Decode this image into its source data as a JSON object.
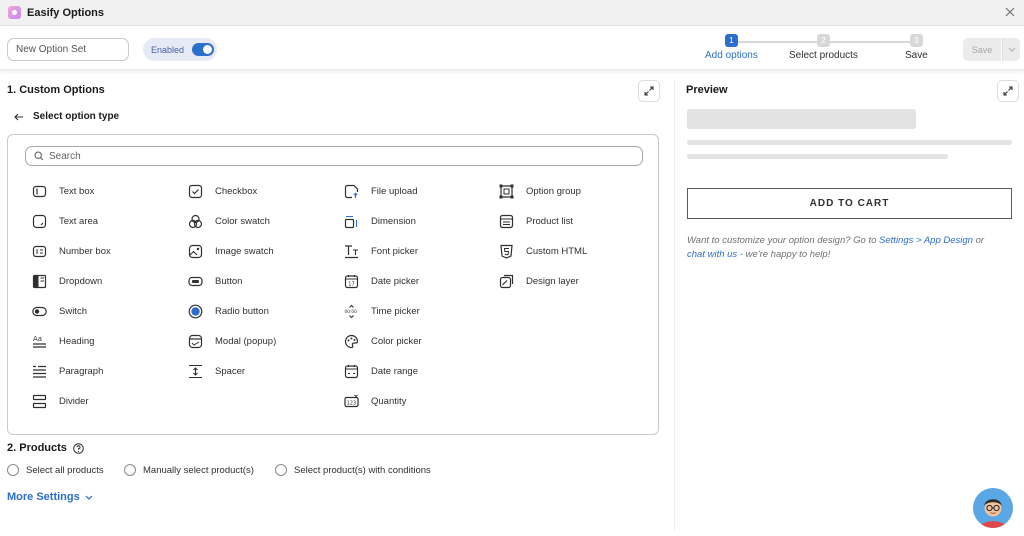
{
  "app": {
    "title": "Easify Options"
  },
  "toolbar": {
    "name_placeholder": "New Option Set",
    "enabled_label": "Enabled",
    "save_label": "Save",
    "steps": [
      {
        "num": "1",
        "label": "Add options",
        "active": true
      },
      {
        "num": "2",
        "label": "Select products",
        "active": false
      },
      {
        "num": "3",
        "label": "Save",
        "active": false
      }
    ]
  },
  "custom_options": {
    "title": "1. Custom Options",
    "back_label": "Select option type",
    "search_placeholder": "Search",
    "types": [
      {
        "label": "Text box",
        "icon": "text-box-icon"
      },
      {
        "label": "Text area",
        "icon": "text-area-icon"
      },
      {
        "label": "Number box",
        "icon": "number-box-icon"
      },
      {
        "label": "Dropdown",
        "icon": "dropdown-icon"
      },
      {
        "label": "Switch",
        "icon": "switch-icon"
      },
      {
        "label": "Heading",
        "icon": "heading-icon"
      },
      {
        "label": "Paragraph",
        "icon": "paragraph-icon"
      },
      {
        "label": "Divider",
        "icon": "divider-icon"
      },
      {
        "label": "Checkbox",
        "icon": "checkbox-icon"
      },
      {
        "label": "Color swatch",
        "icon": "color-swatch-icon"
      },
      {
        "label": "Image swatch",
        "icon": "image-swatch-icon"
      },
      {
        "label": "Button",
        "icon": "button-icon"
      },
      {
        "label": "Radio button",
        "icon": "radio-button-icon"
      },
      {
        "label": "Modal (popup)",
        "icon": "modal-icon"
      },
      {
        "label": "Spacer",
        "icon": "spacer-icon"
      },
      {
        "label": "File upload",
        "icon": "file-upload-icon"
      },
      {
        "label": "Dimension",
        "icon": "dimension-icon"
      },
      {
        "label": "Font picker",
        "icon": "font-picker-icon"
      },
      {
        "label": "Date picker",
        "icon": "date-picker-icon"
      },
      {
        "label": "Time picker",
        "icon": "time-picker-icon"
      },
      {
        "label": "Color picker",
        "icon": "color-picker-icon"
      },
      {
        "label": "Date range",
        "icon": "date-range-icon"
      },
      {
        "label": "Quantity",
        "icon": "quantity-icon"
      },
      {
        "label": "Option group",
        "icon": "option-group-icon"
      },
      {
        "label": "Product list",
        "icon": "product-list-icon"
      },
      {
        "label": "Custom HTML",
        "icon": "custom-html-icon"
      },
      {
        "label": "Design layer",
        "icon": "design-layer-icon"
      }
    ]
  },
  "products": {
    "title": "2. Products",
    "options": [
      "Select all products",
      "Manually select product(s)",
      "Select product(s) with conditions"
    ]
  },
  "more_settings": "More Settings",
  "preview": {
    "title": "Preview",
    "cart_button": "ADD TO CART",
    "help_prefix": "Want to customize your option design? Go to ",
    "help_link1": "Settings > App Design",
    "help_mid": " or",
    "help_link2": "chat with us",
    "help_suffix": " - we're happy to help!"
  },
  "colors": {
    "accent": "#2c6ecb",
    "toggle": "#2c6ecb",
    "step_active": "#2c6ecb",
    "step_inactive": "#d8d8d8"
  }
}
